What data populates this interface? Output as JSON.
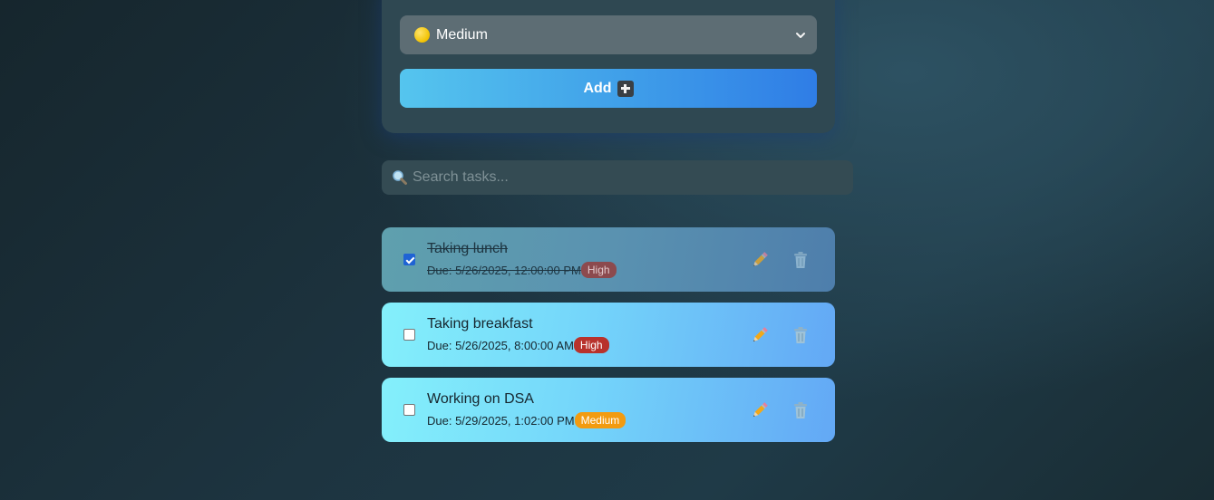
{
  "form": {
    "priority_select": {
      "selected": "Medium",
      "icon": "yellow-circle-icon",
      "options_visible": [
        "Medium"
      ]
    },
    "add_button_label": "Add",
    "add_button_icon": "plus-icon"
  },
  "search": {
    "placeholder": "Search tasks...",
    "value": "",
    "icon": "search-icon"
  },
  "tasks": [
    {
      "title": "Taking lunch",
      "due": "Due: 5/26/2025, 12:00:00 PM",
      "priority": "High",
      "completed": true
    },
    {
      "title": "Taking breakfast",
      "due": "Due: 5/26/2025, 8:00:00 AM",
      "priority": "High",
      "completed": false
    },
    {
      "title": "Working on DSA",
      "due": "Due: 5/29/2025, 1:02:00 PM",
      "priority": "Medium",
      "completed": false
    }
  ],
  "colors": {
    "high_badge": "#b8322c",
    "medium_badge": "#f29b10",
    "accent": "#2f7de6"
  }
}
